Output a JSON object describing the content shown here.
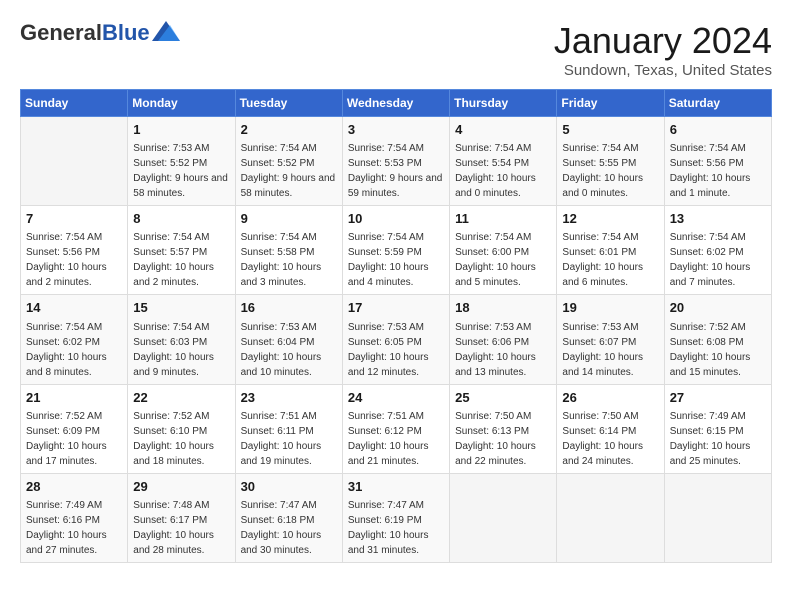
{
  "header": {
    "logo_general": "General",
    "logo_blue": "Blue",
    "month_title": "January 2024",
    "location": "Sundown, Texas, United States"
  },
  "days_of_week": [
    "Sunday",
    "Monday",
    "Tuesday",
    "Wednesday",
    "Thursday",
    "Friday",
    "Saturday"
  ],
  "weeks": [
    [
      {
        "day": "",
        "empty": true
      },
      {
        "day": "1",
        "sunrise": "Sunrise: 7:53 AM",
        "sunset": "Sunset: 5:52 PM",
        "daylight": "Daylight: 9 hours and 58 minutes."
      },
      {
        "day": "2",
        "sunrise": "Sunrise: 7:54 AM",
        "sunset": "Sunset: 5:52 PM",
        "daylight": "Daylight: 9 hours and 58 minutes."
      },
      {
        "day": "3",
        "sunrise": "Sunrise: 7:54 AM",
        "sunset": "Sunset: 5:53 PM",
        "daylight": "Daylight: 9 hours and 59 minutes."
      },
      {
        "day": "4",
        "sunrise": "Sunrise: 7:54 AM",
        "sunset": "Sunset: 5:54 PM",
        "daylight": "Daylight: 10 hours and 0 minutes."
      },
      {
        "day": "5",
        "sunrise": "Sunrise: 7:54 AM",
        "sunset": "Sunset: 5:55 PM",
        "daylight": "Daylight: 10 hours and 0 minutes."
      },
      {
        "day": "6",
        "sunrise": "Sunrise: 7:54 AM",
        "sunset": "Sunset: 5:56 PM",
        "daylight": "Daylight: 10 hours and 1 minute."
      }
    ],
    [
      {
        "day": "7",
        "sunrise": "Sunrise: 7:54 AM",
        "sunset": "Sunset: 5:56 PM",
        "daylight": "Daylight: 10 hours and 2 minutes."
      },
      {
        "day": "8",
        "sunrise": "Sunrise: 7:54 AM",
        "sunset": "Sunset: 5:57 PM",
        "daylight": "Daylight: 10 hours and 2 minutes."
      },
      {
        "day": "9",
        "sunrise": "Sunrise: 7:54 AM",
        "sunset": "Sunset: 5:58 PM",
        "daylight": "Daylight: 10 hours and 3 minutes."
      },
      {
        "day": "10",
        "sunrise": "Sunrise: 7:54 AM",
        "sunset": "Sunset: 5:59 PM",
        "daylight": "Daylight: 10 hours and 4 minutes."
      },
      {
        "day": "11",
        "sunrise": "Sunrise: 7:54 AM",
        "sunset": "Sunset: 6:00 PM",
        "daylight": "Daylight: 10 hours and 5 minutes."
      },
      {
        "day": "12",
        "sunrise": "Sunrise: 7:54 AM",
        "sunset": "Sunset: 6:01 PM",
        "daylight": "Daylight: 10 hours and 6 minutes."
      },
      {
        "day": "13",
        "sunrise": "Sunrise: 7:54 AM",
        "sunset": "Sunset: 6:02 PM",
        "daylight": "Daylight: 10 hours and 7 minutes."
      }
    ],
    [
      {
        "day": "14",
        "sunrise": "Sunrise: 7:54 AM",
        "sunset": "Sunset: 6:02 PM",
        "daylight": "Daylight: 10 hours and 8 minutes."
      },
      {
        "day": "15",
        "sunrise": "Sunrise: 7:54 AM",
        "sunset": "Sunset: 6:03 PM",
        "daylight": "Daylight: 10 hours and 9 minutes."
      },
      {
        "day": "16",
        "sunrise": "Sunrise: 7:53 AM",
        "sunset": "Sunset: 6:04 PM",
        "daylight": "Daylight: 10 hours and 10 minutes."
      },
      {
        "day": "17",
        "sunrise": "Sunrise: 7:53 AM",
        "sunset": "Sunset: 6:05 PM",
        "daylight": "Daylight: 10 hours and 12 minutes."
      },
      {
        "day": "18",
        "sunrise": "Sunrise: 7:53 AM",
        "sunset": "Sunset: 6:06 PM",
        "daylight": "Daylight: 10 hours and 13 minutes."
      },
      {
        "day": "19",
        "sunrise": "Sunrise: 7:53 AM",
        "sunset": "Sunset: 6:07 PM",
        "daylight": "Daylight: 10 hours and 14 minutes."
      },
      {
        "day": "20",
        "sunrise": "Sunrise: 7:52 AM",
        "sunset": "Sunset: 6:08 PM",
        "daylight": "Daylight: 10 hours and 15 minutes."
      }
    ],
    [
      {
        "day": "21",
        "sunrise": "Sunrise: 7:52 AM",
        "sunset": "Sunset: 6:09 PM",
        "daylight": "Daylight: 10 hours and 17 minutes."
      },
      {
        "day": "22",
        "sunrise": "Sunrise: 7:52 AM",
        "sunset": "Sunset: 6:10 PM",
        "daylight": "Daylight: 10 hours and 18 minutes."
      },
      {
        "day": "23",
        "sunrise": "Sunrise: 7:51 AM",
        "sunset": "Sunset: 6:11 PM",
        "daylight": "Daylight: 10 hours and 19 minutes."
      },
      {
        "day": "24",
        "sunrise": "Sunrise: 7:51 AM",
        "sunset": "Sunset: 6:12 PM",
        "daylight": "Daylight: 10 hours and 21 minutes."
      },
      {
        "day": "25",
        "sunrise": "Sunrise: 7:50 AM",
        "sunset": "Sunset: 6:13 PM",
        "daylight": "Daylight: 10 hours and 22 minutes."
      },
      {
        "day": "26",
        "sunrise": "Sunrise: 7:50 AM",
        "sunset": "Sunset: 6:14 PM",
        "daylight": "Daylight: 10 hours and 24 minutes."
      },
      {
        "day": "27",
        "sunrise": "Sunrise: 7:49 AM",
        "sunset": "Sunset: 6:15 PM",
        "daylight": "Daylight: 10 hours and 25 minutes."
      }
    ],
    [
      {
        "day": "28",
        "sunrise": "Sunrise: 7:49 AM",
        "sunset": "Sunset: 6:16 PM",
        "daylight": "Daylight: 10 hours and 27 minutes."
      },
      {
        "day": "29",
        "sunrise": "Sunrise: 7:48 AM",
        "sunset": "Sunset: 6:17 PM",
        "daylight": "Daylight: 10 hours and 28 minutes."
      },
      {
        "day": "30",
        "sunrise": "Sunrise: 7:47 AM",
        "sunset": "Sunset: 6:18 PM",
        "daylight": "Daylight: 10 hours and 30 minutes."
      },
      {
        "day": "31",
        "sunrise": "Sunrise: 7:47 AM",
        "sunset": "Sunset: 6:19 PM",
        "daylight": "Daylight: 10 hours and 31 minutes."
      },
      {
        "day": "",
        "empty": true
      },
      {
        "day": "",
        "empty": true
      },
      {
        "day": "",
        "empty": true
      }
    ]
  ]
}
